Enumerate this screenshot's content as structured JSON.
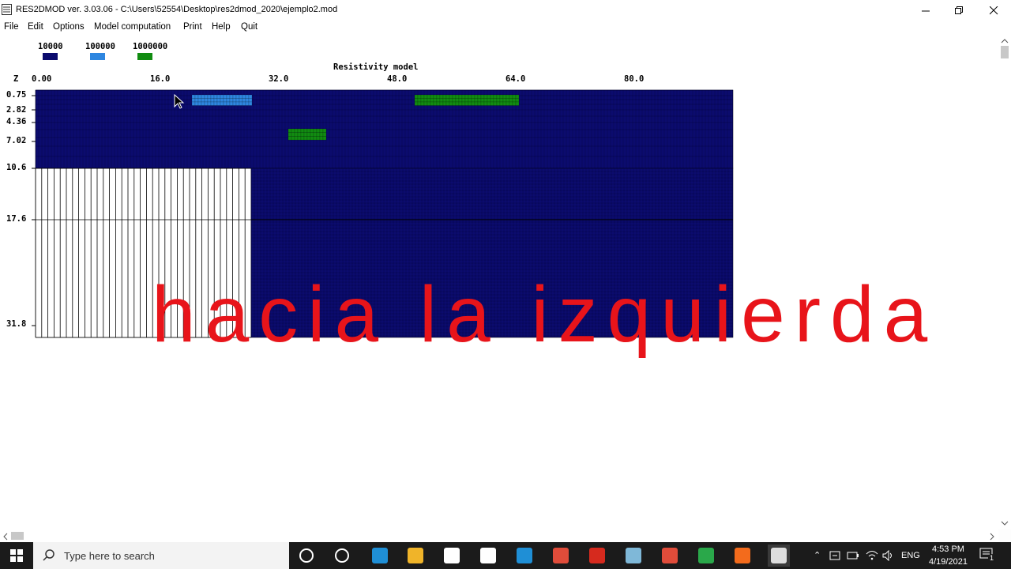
{
  "window": {
    "title": "RES2DMOD ver. 3.03.06 - C:\\Users\\52554\\Desktop\\res2dmod_2020\\ejemplo2.mod"
  },
  "menu": [
    "File",
    "Edit",
    "Options",
    "Model computation",
    "Print",
    "Help",
    "Quit"
  ],
  "legend": [
    {
      "label": "10000",
      "color": "#0b0b6e"
    },
    {
      "label": "100000",
      "color": "#2e86e0"
    },
    {
      "label": "1000000",
      "color": "#118c11"
    }
  ],
  "model": {
    "title": "Resistivity model",
    "z_label": "Z",
    "x_ticks": [
      "0.00",
      "16.0",
      "32.0",
      "48.0",
      "64.0",
      "80.0"
    ],
    "depth_ticks": [
      "0.75",
      "2.82",
      "4.36",
      "7.02",
      "10.6",
      "17.6",
      "31.8"
    ],
    "colors": {
      "background": "#0b0b6e",
      "light_blue": "#2e86e0",
      "green": "#118c11"
    }
  },
  "overlay_caption": "hacia la izquierda",
  "taskbar": {
    "search_placeholder": "Type here to search",
    "language": "ENG",
    "time": "4:53 PM",
    "date": "4/19/2021",
    "notification_count": "1",
    "apps": [
      "cortana-icon",
      "task-view-icon",
      "edge-icon",
      "file-explorer-icon",
      "store-icon",
      "mail-icon",
      "l-app-icon",
      "anydesk-icon",
      "acrobat-icon",
      "notes-icon",
      "anydesk-icon-2",
      "res2dinv-x32-icon",
      "firefox-icon",
      "res2dmod-icon"
    ]
  }
}
